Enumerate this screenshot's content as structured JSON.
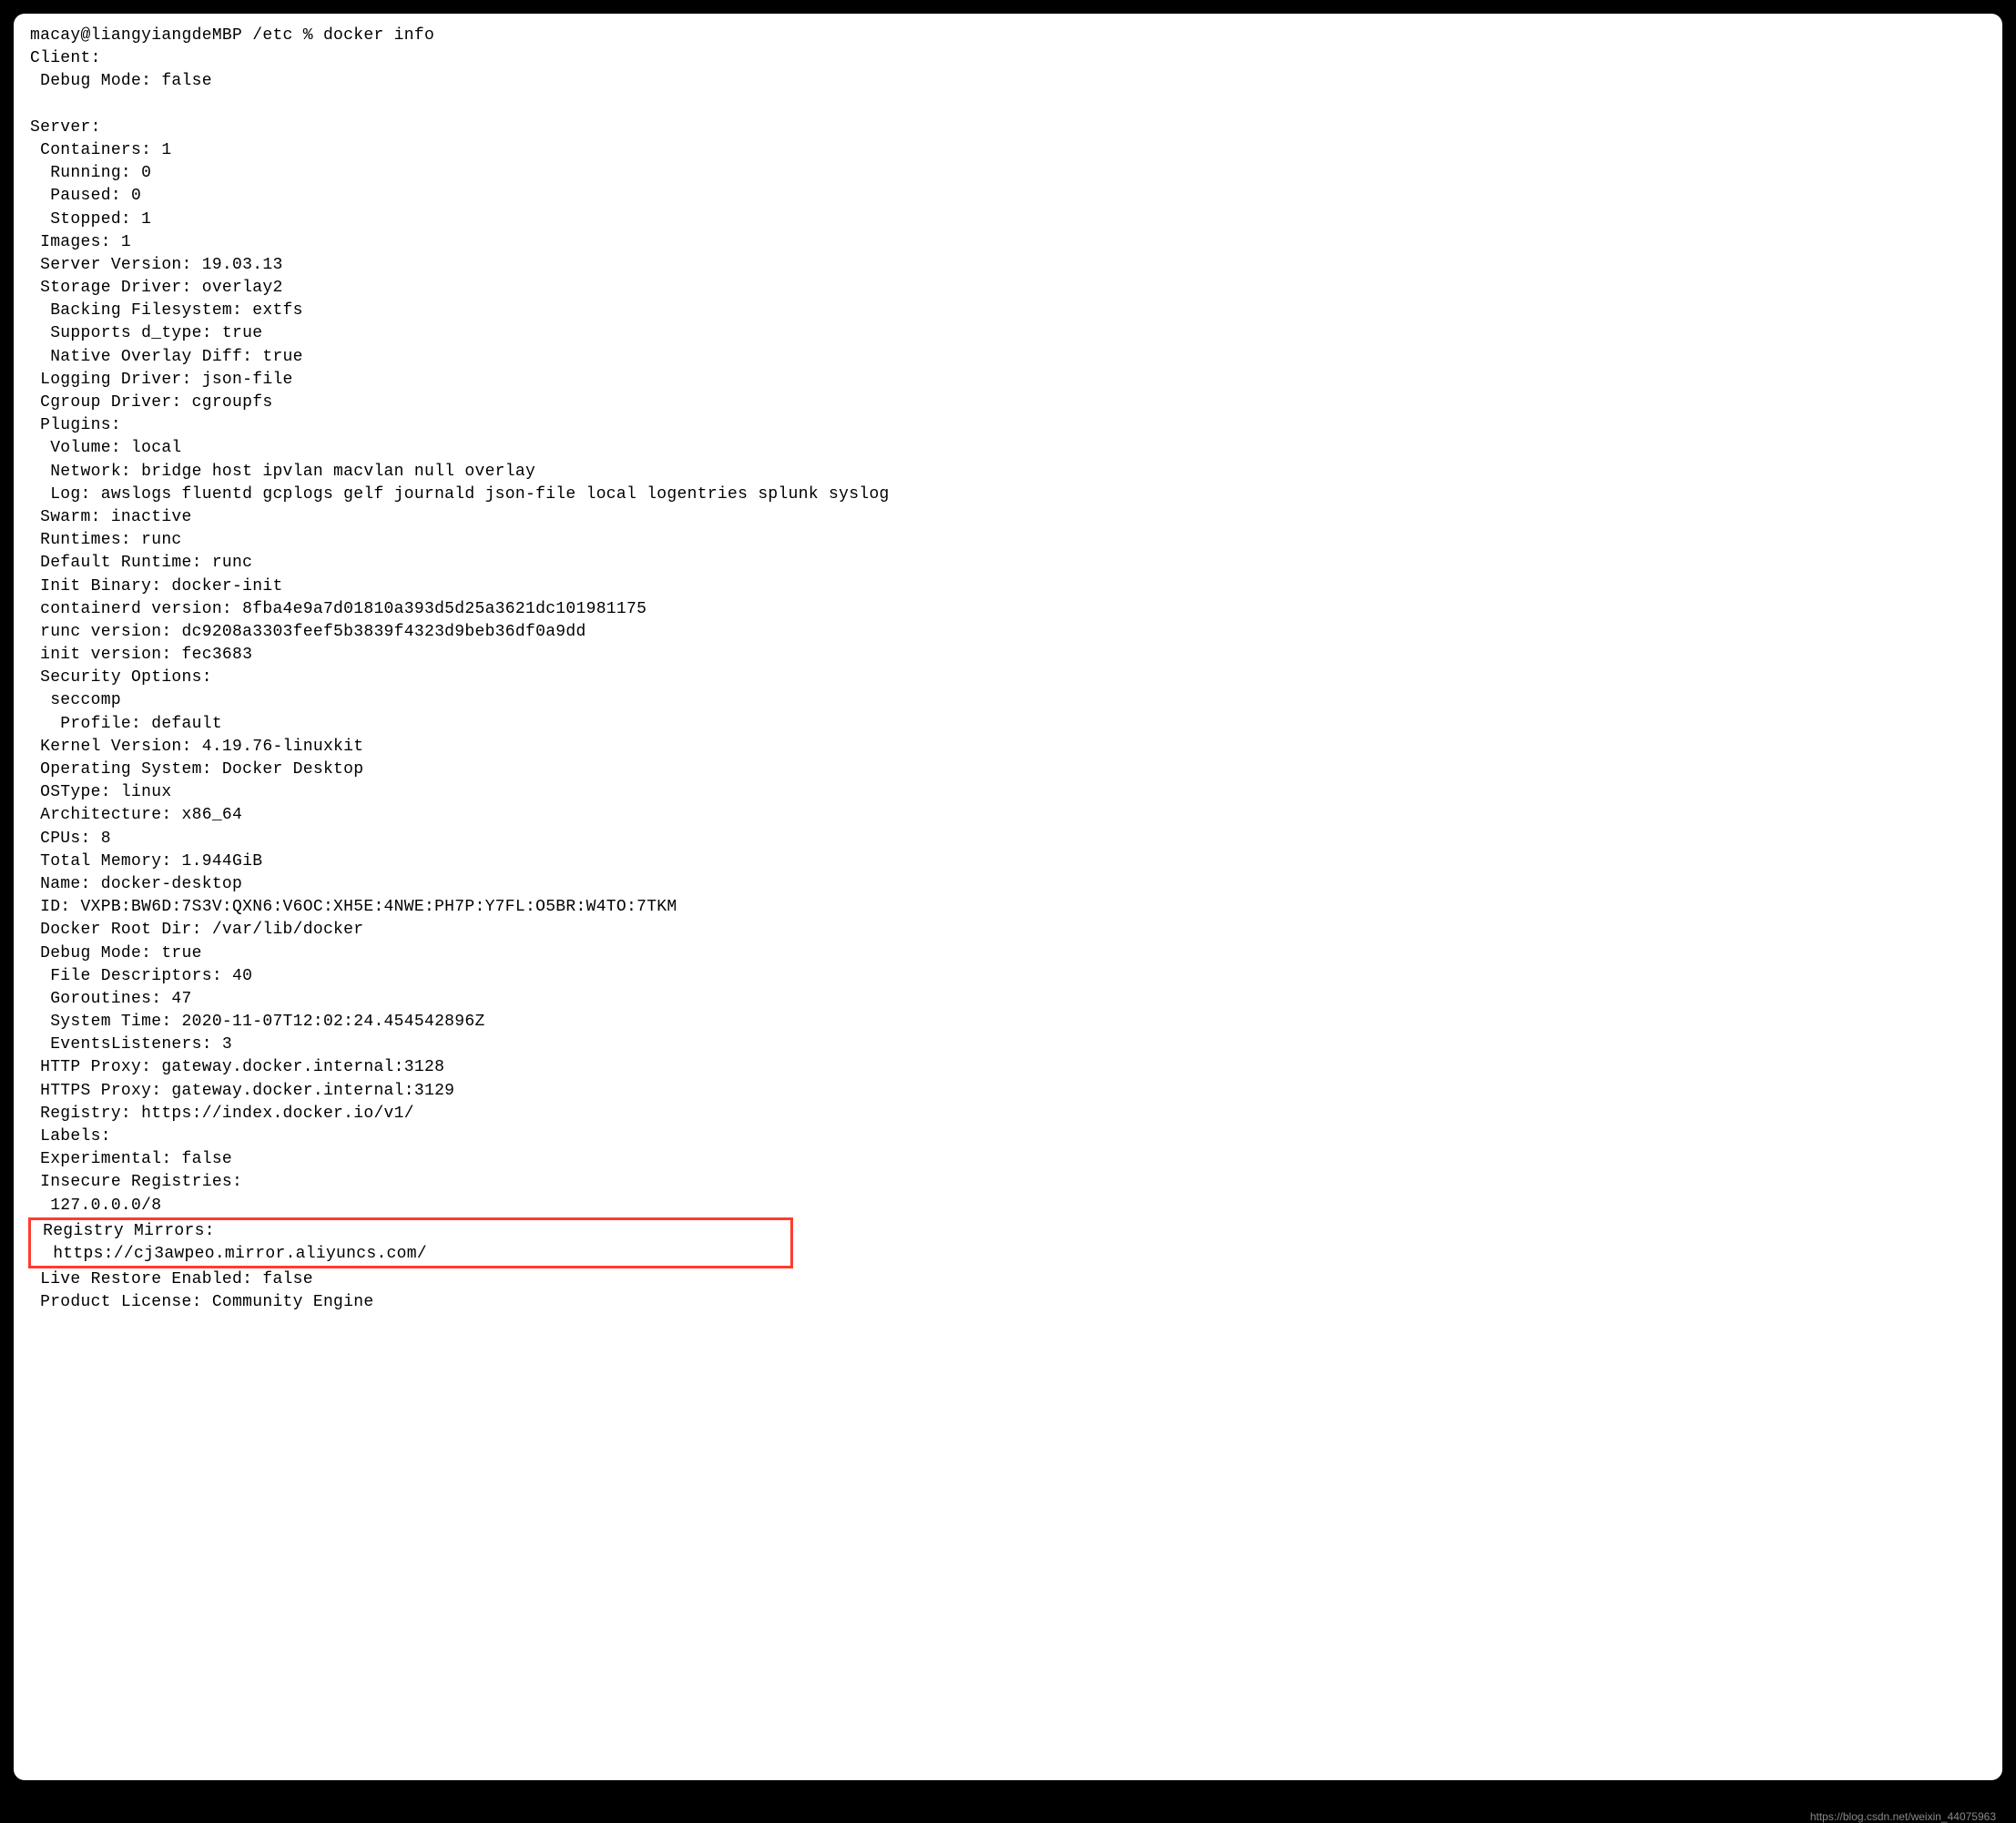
{
  "prompt": "macay@liangyiangdeMBP /etc % docker info",
  "client_header": "Client:",
  "client": {
    "debug_mode": " Debug Mode: false"
  },
  "server_header": "Server:",
  "server": {
    "containers": " Containers: 1",
    "running": "  Running: 0",
    "paused": "  Paused: 0",
    "stopped": "  Stopped: 1",
    "images": " Images: 1",
    "server_version": " Server Version: 19.03.13",
    "storage_driver": " Storage Driver: overlay2",
    "backing_fs": "  Backing Filesystem: extfs",
    "supports_dtype": "  Supports d_type: true",
    "native_overlay": "  Native Overlay Diff: true",
    "logging_driver": " Logging Driver: json-file",
    "cgroup_driver": " Cgroup Driver: cgroupfs",
    "plugins": " Plugins:",
    "volume": "  Volume: local",
    "network": "  Network: bridge host ipvlan macvlan null overlay",
    "log": "  Log: awslogs fluentd gcplogs gelf journald json-file local logentries splunk syslog",
    "swarm": " Swarm: inactive",
    "runtimes": " Runtimes: runc",
    "default_runtime": " Default Runtime: runc",
    "init_binary": " Init Binary: docker-init",
    "containerd_version": " containerd version: 8fba4e9a7d01810a393d5d25a3621dc101981175",
    "runc_version": " runc version: dc9208a3303feef5b3839f4323d9beb36df0a9dd",
    "init_version": " init version: fec3683",
    "security_options": " Security Options:",
    "seccomp": "  seccomp",
    "profile": "   Profile: default",
    "kernel_version": " Kernel Version: 4.19.76-linuxkit",
    "operating_system": " Operating System: Docker Desktop",
    "ostype": " OSType: linux",
    "architecture": " Architecture: x86_64",
    "cpus": " CPUs: 8",
    "total_memory": " Total Memory: 1.944GiB",
    "name": " Name: docker-desktop",
    "id": " ID: VXPB:BW6D:7S3V:QXN6:V6OC:XH5E:4NWE:PH7P:Y7FL:O5BR:W4TO:7TKM",
    "docker_root": " Docker Root Dir: /var/lib/docker",
    "debug_mode": " Debug Mode: true",
    "file_descriptors": "  File Descriptors: 40",
    "goroutines": "  Goroutines: 47",
    "system_time": "  System Time: 2020-11-07T12:02:24.454542896Z",
    "events_listeners": "  EventsListeners: 3",
    "http_proxy": " HTTP Proxy: gateway.docker.internal:3128",
    "https_proxy": " HTTPS Proxy: gateway.docker.internal:3129",
    "registry": " Registry: https://index.docker.io/v1/",
    "labels": " Labels:",
    "experimental": " Experimental: false",
    "insecure_registries": " Insecure Registries:",
    "insecure_reg_val": "  127.0.0.0/8",
    "registry_mirrors": " Registry Mirrors:",
    "registry_mirror_val": "  https://cj3awpeo.mirror.aliyuncs.com/",
    "live_restore": " Live Restore Enabled: false",
    "product_license": " Product License: Community Engine"
  },
  "watermark": "https://blog.csdn.net/weixin_44075963"
}
